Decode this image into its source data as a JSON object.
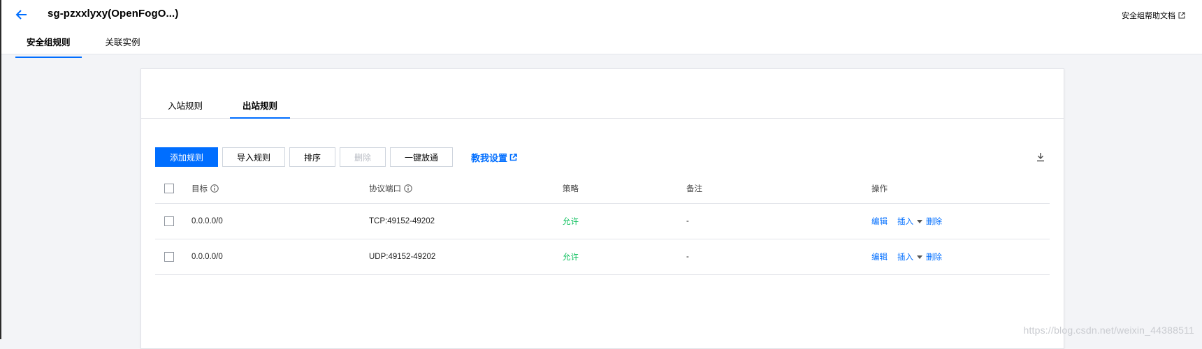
{
  "header": {
    "title": "sg-pzxxlyxy(OpenFogO...)",
    "help_link": "安全组帮助文档",
    "tabs": [
      {
        "label": "安全组规则",
        "active": true
      },
      {
        "label": "关联实例",
        "active": false
      }
    ]
  },
  "rules": {
    "tabs": [
      {
        "label": "入站规则",
        "active": false
      },
      {
        "label": "出站规则",
        "active": true
      }
    ],
    "toolbar": {
      "add_label": "添加规则",
      "import_label": "导入规则",
      "sort_label": "排序",
      "delete_label": "删除",
      "allow_all_label": "一键放通",
      "teach_label": "教我设置"
    },
    "columns": {
      "target": "目标",
      "protocol_port": "协议端口",
      "policy": "策略",
      "remark": "备注",
      "action": "操作"
    },
    "rows": [
      {
        "target": "0.0.0.0/0",
        "protocol_port": "TCP:49152-49202",
        "policy": "允许",
        "remark": "-",
        "edit": "编辑",
        "insert": "插入",
        "delete": "删除"
      },
      {
        "target": "0.0.0.0/0",
        "protocol_port": "UDP:49152-49202",
        "policy": "允许",
        "remark": "-",
        "edit": "编辑",
        "insert": "插入",
        "delete": "删除"
      }
    ]
  },
  "watermark": "https://blog.csdn.net/weixin_44388511",
  "colors": {
    "accent": "#006eff",
    "allow": "#0abf5b",
    "disabled_text": "#b8bcc4",
    "background": "#f3f4f7"
  },
  "icons": [
    "back-arrow-icon",
    "external-link-icon",
    "info-icon",
    "download-icon",
    "caret-down-icon"
  ]
}
